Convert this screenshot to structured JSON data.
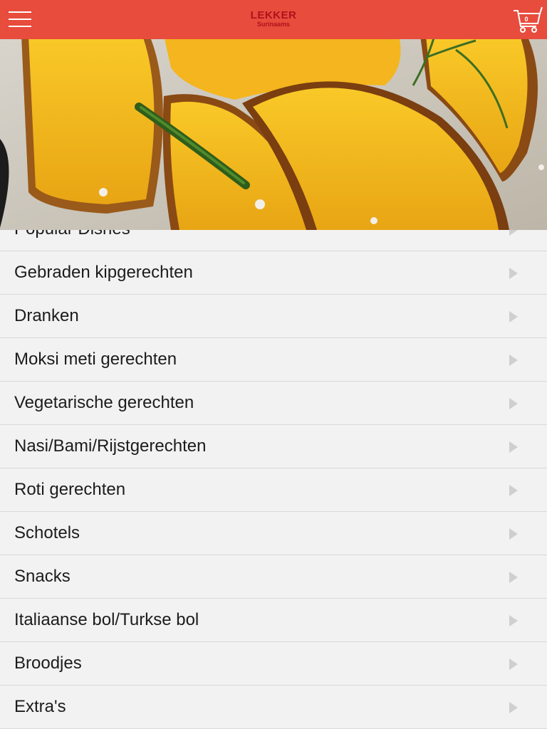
{
  "header": {
    "logo_main": "LEKKER",
    "logo_sub": "Surinaams",
    "cart_count": "0",
    "background_color": "#e74c3c",
    "logo_color": "#b0101e"
  },
  "hero": {
    "image": "roasted-pumpkin-with-rosemary"
  },
  "categories": [
    {
      "label": "Popular Dishes"
    },
    {
      "label": "Gebraden kipgerechten"
    },
    {
      "label": "Dranken"
    },
    {
      "label": "Moksi meti gerechten"
    },
    {
      "label": "Vegetarische gerechten"
    },
    {
      "label": "Nasi/Bami/Rijstgerechten"
    },
    {
      "label": "Roti gerechten"
    },
    {
      "label": "Schotels"
    },
    {
      "label": "Snacks"
    },
    {
      "label": "Italiaanse bol/Turkse bol"
    },
    {
      "label": "Broodjes"
    },
    {
      "label": "Extra's"
    }
  ],
  "icons": {
    "menu": "hamburger-menu-icon",
    "cart": "shopping-cart-icon",
    "row": "chevron-right-icon"
  }
}
